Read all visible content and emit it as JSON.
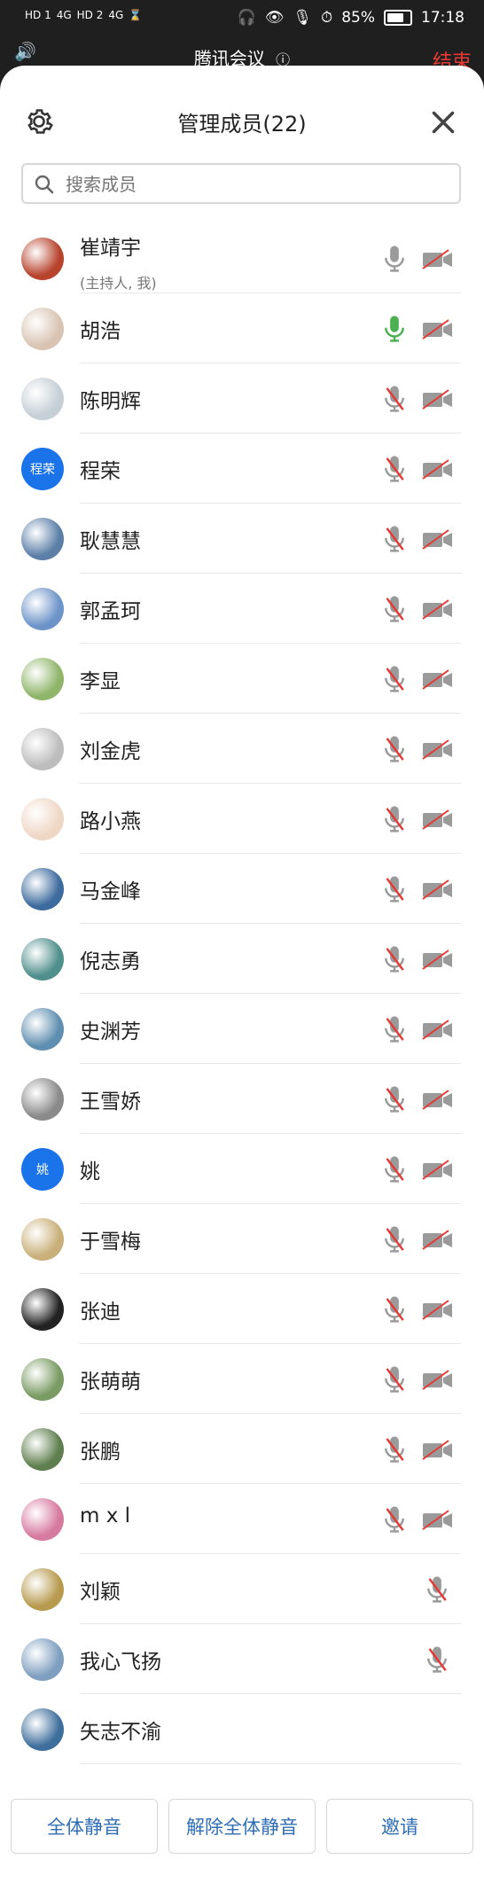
{
  "status_bar": {
    "left_indicators": [
      "HD 1",
      "4G",
      "HD 2",
      "4G"
    ],
    "battery": "85%",
    "time": "17:18"
  },
  "meeting": {
    "title": "腾讯会议",
    "end_label": "结束"
  },
  "panel": {
    "title": "管理成员(22)",
    "search_placeholder": "搜索成员"
  },
  "members": [
    {
      "name": "崔靖宇",
      "subtitle": "(主持人, 我)",
      "avatar": "photo",
      "avatar_color": "#b7432c",
      "mic": "on",
      "camera": "off"
    },
    {
      "name": "胡浩",
      "avatar": "photo",
      "avatar_color": "#d9c4b3",
      "mic": "on-green",
      "camera": "off"
    },
    {
      "name": "陈明辉",
      "avatar": "photo",
      "avatar_color": "#c5cfd6",
      "mic": "off",
      "camera": "off"
    },
    {
      "name": "程荣",
      "avatar": "text",
      "avatar_text": "程荣",
      "avatar_color": "#1a73e8",
      "mic": "off",
      "camera": "off"
    },
    {
      "name": "耿慧慧",
      "avatar": "photo",
      "avatar_color": "#5b7fa7",
      "mic": "off",
      "camera": "off"
    },
    {
      "name": "郭孟珂",
      "avatar": "photo",
      "avatar_color": "#6d94c9",
      "mic": "off",
      "camera": "off"
    },
    {
      "name": "李显",
      "avatar": "photo",
      "avatar_color": "#8fb56a",
      "mic": "off",
      "camera": "off"
    },
    {
      "name": "刘金虎",
      "avatar": "photo",
      "avatar_color": "#bdbdbd",
      "mic": "off",
      "camera": "off"
    },
    {
      "name": "路小燕",
      "avatar": "photo",
      "avatar_color": "#efd7c6",
      "mic": "off",
      "camera": "off"
    },
    {
      "name": "马金峰",
      "avatar": "photo",
      "avatar_color": "#3d6b9e",
      "mic": "off",
      "camera": "off"
    },
    {
      "name": "倪志勇",
      "avatar": "photo",
      "avatar_color": "#4f8f8c",
      "mic": "off",
      "camera": "off"
    },
    {
      "name": "史渊芳",
      "avatar": "photo",
      "avatar_color": "#5f8fb0",
      "mic": "off",
      "camera": "off"
    },
    {
      "name": "王雪娇",
      "avatar": "photo",
      "avatar_color": "#8a8a8a",
      "mic": "off",
      "camera": "off"
    },
    {
      "name": "姚",
      "avatar": "text",
      "avatar_text": "姚",
      "avatar_color": "#1a73e8",
      "mic": "off",
      "camera": "off"
    },
    {
      "name": "于雪梅",
      "avatar": "photo",
      "avatar_color": "#c9b07a",
      "mic": "off",
      "camera": "off"
    },
    {
      "name": "张迪",
      "avatar": "photo",
      "avatar_color": "#222222",
      "mic": "off",
      "camera": "off"
    },
    {
      "name": "张萌萌",
      "avatar": "photo",
      "avatar_color": "#7a9b63",
      "mic": "off",
      "camera": "off"
    },
    {
      "name": "张鹏",
      "avatar": "photo",
      "avatar_color": "#5f7f4e",
      "mic": "off",
      "camera": "off"
    },
    {
      "name": "m x l",
      "avatar": "photo",
      "avatar_color": "#d77aa0",
      "mic": "off",
      "camera": "off"
    },
    {
      "name": "刘颖",
      "avatar": "photo",
      "avatar_color": "#b79a4e",
      "mic": "off-solo",
      "camera": "none"
    },
    {
      "name": "我心飞扬",
      "avatar": "photo",
      "avatar_color": "#7f9fc0",
      "mic": "off-solo",
      "camera": "none"
    },
    {
      "name": "矢志不渝",
      "avatar": "photo",
      "avatar_color": "#3e6f9c",
      "mic": "none",
      "camera": "none"
    }
  ],
  "footer": {
    "mute_all": "全体静音",
    "unmute_all": "解除全体静音",
    "invite": "邀请"
  },
  "colors": {
    "accent_blue": "#2e6db4",
    "end_red": "#e53935",
    "mic_green": "#4caf50",
    "mic_off_red": "#e53935",
    "icon_gray": "#9a9a9a"
  }
}
